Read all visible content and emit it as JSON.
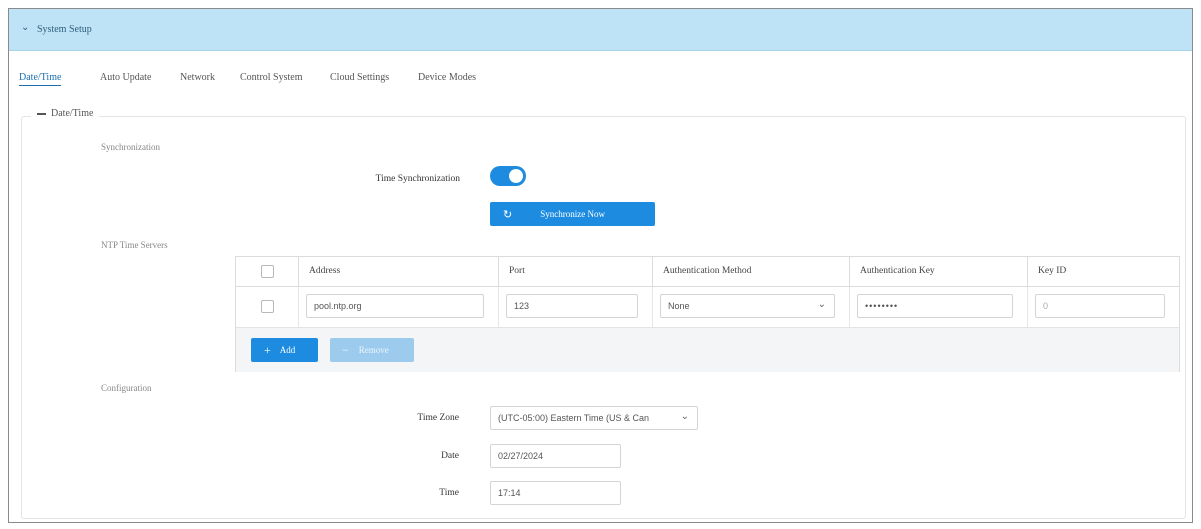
{
  "header": {
    "title": "System Setup"
  },
  "tabs": [
    {
      "label": "Date/Time",
      "active": true
    },
    {
      "label": "Auto Update"
    },
    {
      "label": "Network"
    },
    {
      "label": "Control System"
    },
    {
      "label": "Cloud Settings"
    },
    {
      "label": "Device Modes"
    }
  ],
  "datetime": {
    "legend": "Date/Time",
    "sync_section": "Synchronization",
    "time_sync_label": "Time Synchronization",
    "time_sync_enabled": true,
    "sync_now_label": "Synchronize Now",
    "ntp_section": "NTP Time Servers",
    "ntp_columns": [
      "Address",
      "Port",
      "Authentication Method",
      "Authentication Key",
      "Key ID"
    ],
    "ntp_rows": [
      {
        "address": "pool.ntp.org",
        "port": "123",
        "auth_method": "None",
        "auth_key": "••••••••",
        "key_id": "0"
      }
    ],
    "add_label": "Add",
    "remove_label": "Remove",
    "config_section": "Configuration",
    "timezone_label": "Time Zone",
    "timezone_value": "(UTC-05:00) Eastern Time (US & Can",
    "date_label": "Date",
    "date_value": "02/27/2024",
    "time_label": "Time",
    "time_value": "17:14"
  },
  "colors": {
    "header_bg": "#bfe3f6",
    "accent": "#1d8ce0"
  }
}
